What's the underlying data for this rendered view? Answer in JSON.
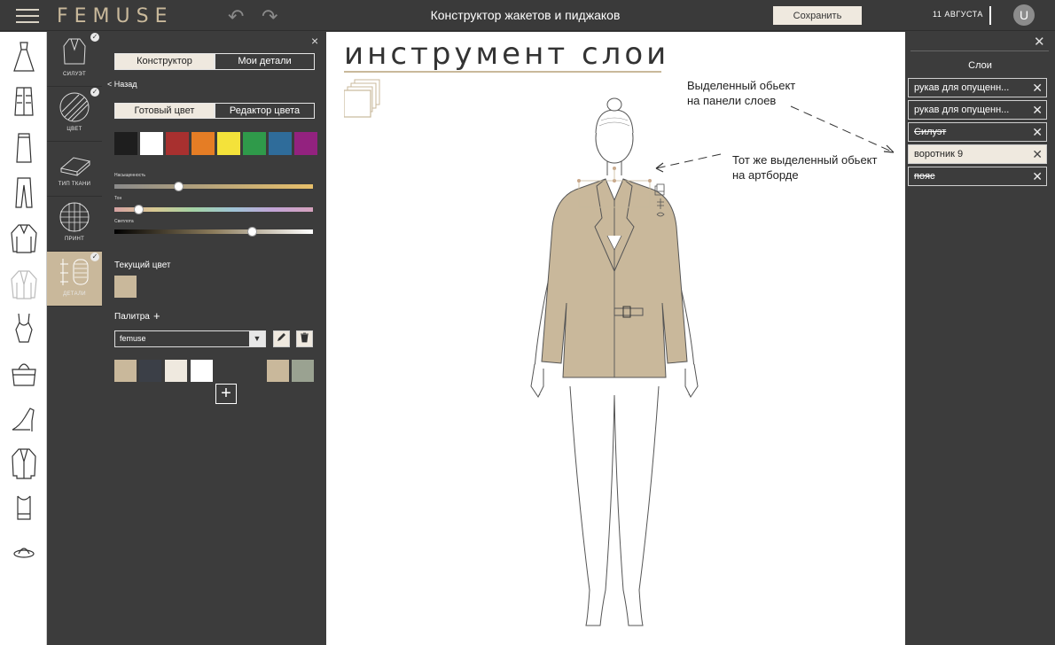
{
  "topbar": {
    "logo": "FEMUSE",
    "title": "Конструктор жакетов и пиджаков",
    "save_label": "Сохранить",
    "date": "11 АВГУСТА",
    "avatar_letter": "U"
  },
  "categories": [
    {
      "label": "СИЛУЭТ",
      "checked": true
    },
    {
      "label": "ЦВЕТ",
      "checked": true
    },
    {
      "label": "ТИП ТКАНИ",
      "checked": false
    },
    {
      "label": "ПРИНТ",
      "checked": false
    },
    {
      "label": "ДЕТАЛИ",
      "checked": true
    }
  ],
  "panel": {
    "close_icon": "×",
    "tab_constructor": "Конструктор",
    "tab_my_details": "Мои детали",
    "back_label": "< Назад",
    "subtab_ready": "Готовый цвет",
    "subtab_editor": "Редактор цвета",
    "swatches": [
      "#1e1e1e",
      "#ffffff",
      "#a8302f",
      "#e57d25",
      "#f4e23a",
      "#2f9a4a",
      "#2f6c9a",
      "#93227f"
    ],
    "saturation_label": "Насыщенность",
    "tone_label": "Тон",
    "lightness_label": "Светлота",
    "saturation_value": 0.32,
    "tone_value": 0.12,
    "lightness_value": 0.69,
    "current_color_label": "Текущий цвет",
    "current_color": "#c9b89b",
    "palette_label": "Палитра",
    "palette_add": "+",
    "palette_value": "femuse",
    "palette_colors": [
      "#c9b89b",
      "#3b3f47",
      "#efe9df",
      "#ffffff",
      "#c9b89b",
      "#9aa291"
    ]
  },
  "canvas": {
    "title": "инструмент слои",
    "annotation_1_line1": "Выделенный обьект",
    "annotation_1_line2": "на панели слоев",
    "annotation_2_line1": "Тот же выделенный обьект",
    "annotation_2_line2": "на артборде",
    "jacket_color": "#c9b89b"
  },
  "layers": {
    "title": "Слои",
    "items": [
      {
        "name": "рукав для опущенн...",
        "selected": false
      },
      {
        "name": "рукав для опущенн...",
        "selected": false
      },
      {
        "name": "Силуэт",
        "selected": false
      },
      {
        "name": "воротник 9",
        "selected": true
      },
      {
        "name": "пояс",
        "selected": false
      }
    ]
  }
}
